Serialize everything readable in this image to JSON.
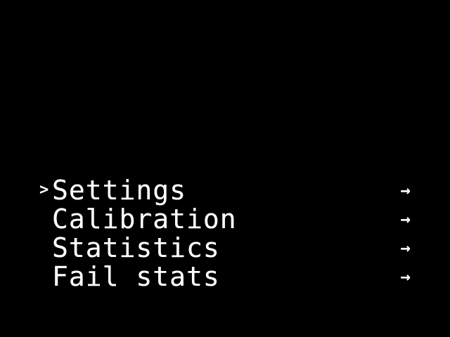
{
  "menu": {
    "cursor": ">",
    "items": [
      {
        "label": "Settings",
        "arrow": "→",
        "selected": true
      },
      {
        "label": "Calibration",
        "arrow": "→",
        "selected": false
      },
      {
        "label": "Statistics",
        "arrow": "→",
        "selected": false
      },
      {
        "label": "Fail stats",
        "arrow": "→",
        "selected": false
      }
    ]
  },
  "colors": {
    "background": "#000000",
    "text": "#ffffff"
  }
}
